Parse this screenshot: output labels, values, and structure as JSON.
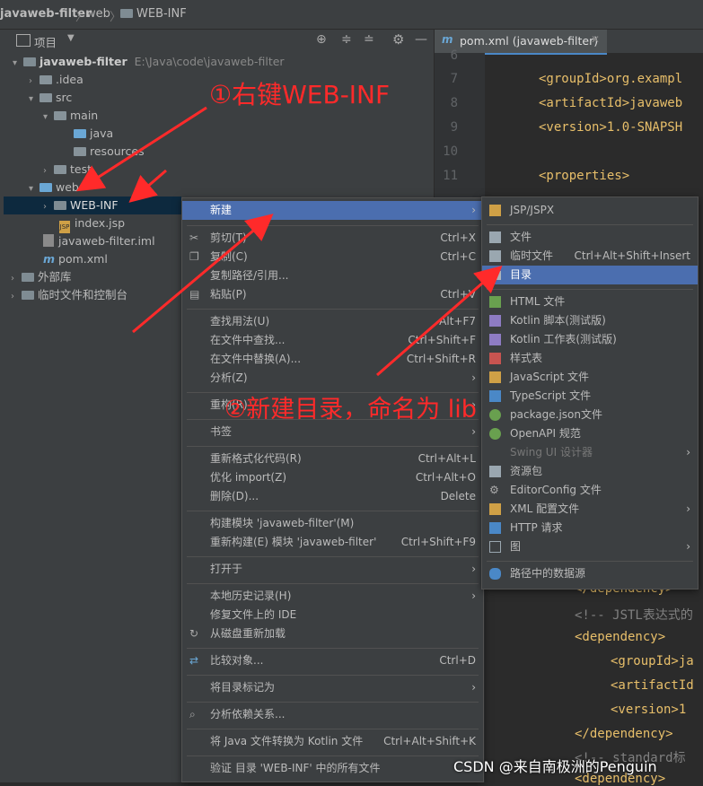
{
  "breadcrumb": {
    "project": "javaweb-filter",
    "folder1": "web",
    "folder2": "WEB-INF"
  },
  "project_panel": {
    "title": "项目"
  },
  "tree": [
    {
      "name": "javaweb-filter",
      "extra": "E:\\Java\\code\\javaweb-filter"
    },
    {
      "name": ".idea"
    },
    {
      "name": "src"
    },
    {
      "name": "main"
    },
    {
      "name": "java"
    },
    {
      "name": "resources"
    },
    {
      "name": "test"
    },
    {
      "name": "web"
    },
    {
      "name": "WEB-INF"
    },
    {
      "name": "index.jsp"
    },
    {
      "name": "javaweb-filter.iml"
    },
    {
      "name": "pom.xml"
    },
    {
      "name": "外部库"
    },
    {
      "name": "临时文件和控制台"
    }
  ],
  "editor_tab": {
    "label": "pom.xml (javaweb-filter)"
  },
  "line_numbers": [
    "6",
    "7",
    "8",
    "9",
    "10",
    "11"
  ],
  "code": {
    "groupId": "<groupId>org.exampl",
    "artifactId": "<artifactId>javaweb",
    "version": "<version>1.0-SNAPSH",
    "properties": "<properties>",
    "dep_close1": "</dependency>",
    "comment": "<!-- JSTL表达式的",
    "dep_open": "<dependency>",
    "groupId2": "<groupId>ja",
    "artifactId2": "<artifactId",
    "version2": "<version>1",
    "dep_close2": "</dependency>",
    "comment2": "<!-- standard标",
    "dep_open2": "<dependency>"
  },
  "context_menu": [
    {
      "label": "新建",
      "shortcut": ""
    },
    {
      "label": "剪切(T)",
      "shortcut": "Ctrl+X"
    },
    {
      "label": "复制(C)",
      "shortcut": "Ctrl+C"
    },
    {
      "label": "复制路径/引用...",
      "shortcut": ""
    },
    {
      "label": "粘贴(P)",
      "shortcut": "Ctrl+V"
    },
    {
      "label": "查找用法(U)",
      "shortcut": "Alt+F7"
    },
    {
      "label": "在文件中查找...",
      "shortcut": "Ctrl+Shift+F"
    },
    {
      "label": "在文件中替换(A)...",
      "shortcut": "Ctrl+Shift+R"
    },
    {
      "label": "分析(Z)",
      "shortcut": ""
    },
    {
      "label": "重构(R)",
      "shortcut": ""
    },
    {
      "label": "书签",
      "shortcut": ""
    },
    {
      "label": "重新格式化代码(R)",
      "shortcut": "Ctrl+Alt+L"
    },
    {
      "label": "优化 import(Z)",
      "shortcut": "Ctrl+Alt+O"
    },
    {
      "label": "删除(D)...",
      "shortcut": "Delete"
    },
    {
      "label": "构建模块 'javaweb-filter'(M)",
      "shortcut": ""
    },
    {
      "label": "重新构建(E) 模块 'javaweb-filter'",
      "shortcut": "Ctrl+Shift+F9"
    },
    {
      "label": "打开于",
      "shortcut": ""
    },
    {
      "label": "本地历史记录(H)",
      "shortcut": ""
    },
    {
      "label": "修复文件上的 IDE",
      "shortcut": ""
    },
    {
      "label": "从磁盘重新加载",
      "shortcut": ""
    },
    {
      "label": "比较对象...",
      "shortcut": "Ctrl+D"
    },
    {
      "label": "将目录标记为",
      "shortcut": ""
    },
    {
      "label": "分析依赖关系...",
      "shortcut": ""
    },
    {
      "label": "将 Java 文件转换为 Kotlin 文件",
      "shortcut": "Ctrl+Alt+Shift+K"
    },
    {
      "label": "验证 目录 'WEB-INF' 中的所有文件",
      "shortcut": ""
    }
  ],
  "submenu": [
    {
      "label": "JSP/JSPX",
      "shortcut": ""
    },
    {
      "label": "文件",
      "shortcut": ""
    },
    {
      "label": "临时文件",
      "shortcut": "Ctrl+Alt+Shift+Insert"
    },
    {
      "label": "目录",
      "shortcut": ""
    },
    {
      "label": "HTML 文件",
      "shortcut": ""
    },
    {
      "label": "Kotlin 脚本(测试版)",
      "shortcut": ""
    },
    {
      "label": "Kotlin 工作表(测试版)",
      "shortcut": ""
    },
    {
      "label": "样式表",
      "shortcut": ""
    },
    {
      "label": "JavaScript 文件",
      "shortcut": ""
    },
    {
      "label": "TypeScript 文件",
      "shortcut": ""
    },
    {
      "label": "package.json文件",
      "shortcut": ""
    },
    {
      "label": "OpenAPI 规范",
      "shortcut": ""
    },
    {
      "label": "Swing UI 设计器",
      "shortcut": ""
    },
    {
      "label": "资源包",
      "shortcut": ""
    },
    {
      "label": "EditorConfig 文件",
      "shortcut": ""
    },
    {
      "label": "XML 配置文件",
      "shortcut": ""
    },
    {
      "label": "HTTP 请求",
      "shortcut": ""
    },
    {
      "label": "图",
      "shortcut": ""
    },
    {
      "label": "路径中的数据源",
      "shortcut": ""
    }
  ],
  "annotations": {
    "step1": "①右键WEB-INF",
    "step2": "②新建目录，命名为 lib"
  },
  "watermark": "CSDN @来自南极洲的Penguin",
  "colors": {
    "accent": "#4b6eaf",
    "annotation": "#ff2a2a",
    "selected_row": "#0d293e"
  }
}
